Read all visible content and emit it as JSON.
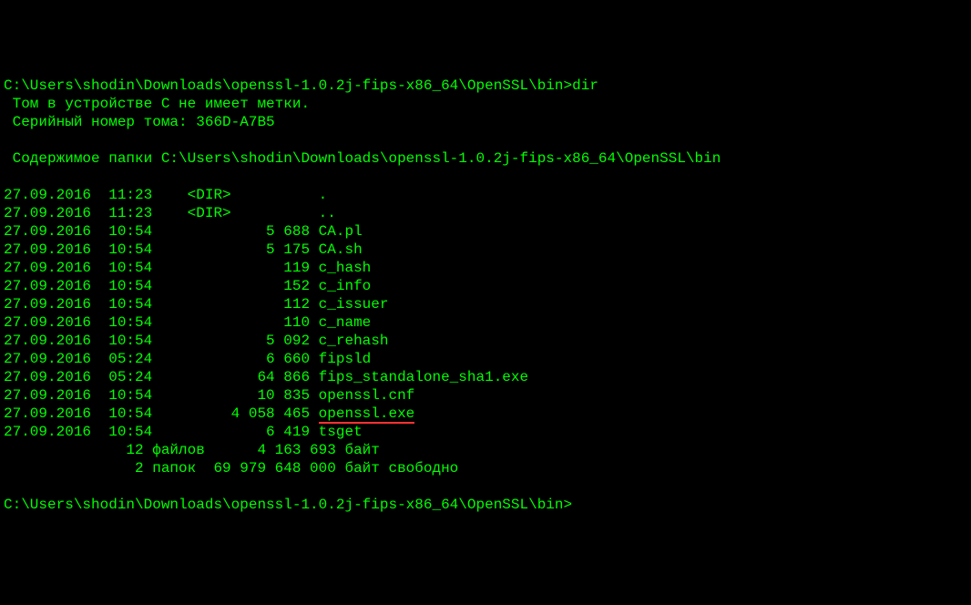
{
  "prompt1": {
    "path": "C:\\Users\\shodin\\Downloads\\openssl-1.0.2j-fips-x86_64\\OpenSSL\\bin>",
    "command": "dir"
  },
  "header": {
    "volume_label": " Том в устройстве C не имеет метки.",
    "serial": " Серийный номер тома: 366D-A7B5"
  },
  "content_header": " Содержимое папки C:\\Users\\shodin\\Downloads\\openssl-1.0.2j-fips-x86_64\\OpenSSL\\bin",
  "rows": [
    "27.09.2016  11:23    <DIR>          .",
    "27.09.2016  11:23    <DIR>          ..",
    "27.09.2016  10:54             5 688 CA.pl",
    "27.09.2016  10:54             5 175 CA.sh",
    "27.09.2016  10:54               119 c_hash",
    "27.09.2016  10:54               152 c_info",
    "27.09.2016  10:54               112 c_issuer",
    "27.09.2016  10:54               110 c_name",
    "27.09.2016  10:54             5 092 c_rehash",
    "27.09.2016  05:24             6 660 fipsld",
    "27.09.2016  05:24            64 866 fips_standalone_sha1.exe",
    "27.09.2016  10:54            10 835 openssl.cnf"
  ],
  "highlighted_row": {
    "prefix": "27.09.2016  10:54         4 058 465 ",
    "filename": "openssl.exe"
  },
  "rows_after": [
    "27.09.2016  10:54             6 419 tsget"
  ],
  "summary": {
    "files": "              12 файлов      4 163 693 байт",
    "folders": "               2 папок  69 979 648 000 байт свободно"
  },
  "prompt2": {
    "path": "C:\\Users\\shodin\\Downloads\\openssl-1.0.2j-fips-x86_64\\OpenSSL\\bin>"
  }
}
